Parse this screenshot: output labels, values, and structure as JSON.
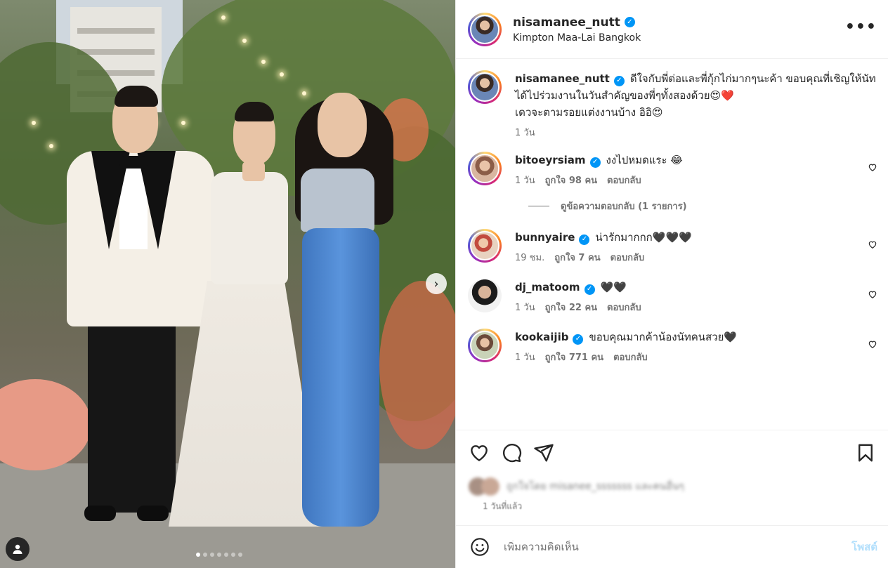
{
  "post": {
    "username": "nisamanee_nutt",
    "location": "Kimpton Maa-Lai Bangkok",
    "more_label": "•••",
    "carousel_next": "›",
    "carousel_dots": 7,
    "carousel_active": 0
  },
  "caption": {
    "username": "nisamanee_nutt",
    "text": "ดีใจกับพี่ต่อและพี่กุ้กไก่มากๆนะค้า ขอบคุณที่เชิญให้นัทได้ไปร่วมงานในวันสำคัญของพี่ๆทั้งสองด้วย😍❤️",
    "text2": "เดวจะตามรอยแต่งงานบ้าง อิอิ😍",
    "time": "1 วัน"
  },
  "comments": [
    {
      "username": "bitoeyrsiam",
      "text": "งงไปหมดแระ 😂",
      "time": "1 วัน",
      "likes": "ถูกใจ 98 คน",
      "reply": "ตอบกลับ",
      "view_replies": "ดูข้อความตอบกลับ (1 รายการ)"
    },
    {
      "username": "bunnyaire",
      "text": "น่ารักมากกก🖤🖤🖤",
      "time": "19 ชม.",
      "likes": "ถูกใจ 7 คน",
      "reply": "ตอบกลับ"
    },
    {
      "username": "dj_matoom",
      "text": "🖤🖤",
      "time": "1 วัน",
      "likes": "ถูกใจ 22 คน",
      "reply": "ตอบกลับ"
    },
    {
      "username": "kookaijib",
      "text": "ขอบคุณมากค้าน้องนัทคนสวย🖤",
      "time": "1 วัน",
      "likes": "ถูกใจ 771 คน",
      "reply": "ตอบกลับ"
    }
  ],
  "liked_by": "ถูกใจโดย misanee_sssssss และคนอื่นๆ",
  "posted_time": "1 วันที่แล้ว",
  "add_comment": {
    "placeholder": "เพิ่มความคิดเห็น",
    "post_label": "โพสต์"
  },
  "colors": {
    "verified": "#0095f6",
    "post_disabled": "#b2dffc",
    "secondary": "#737373"
  }
}
